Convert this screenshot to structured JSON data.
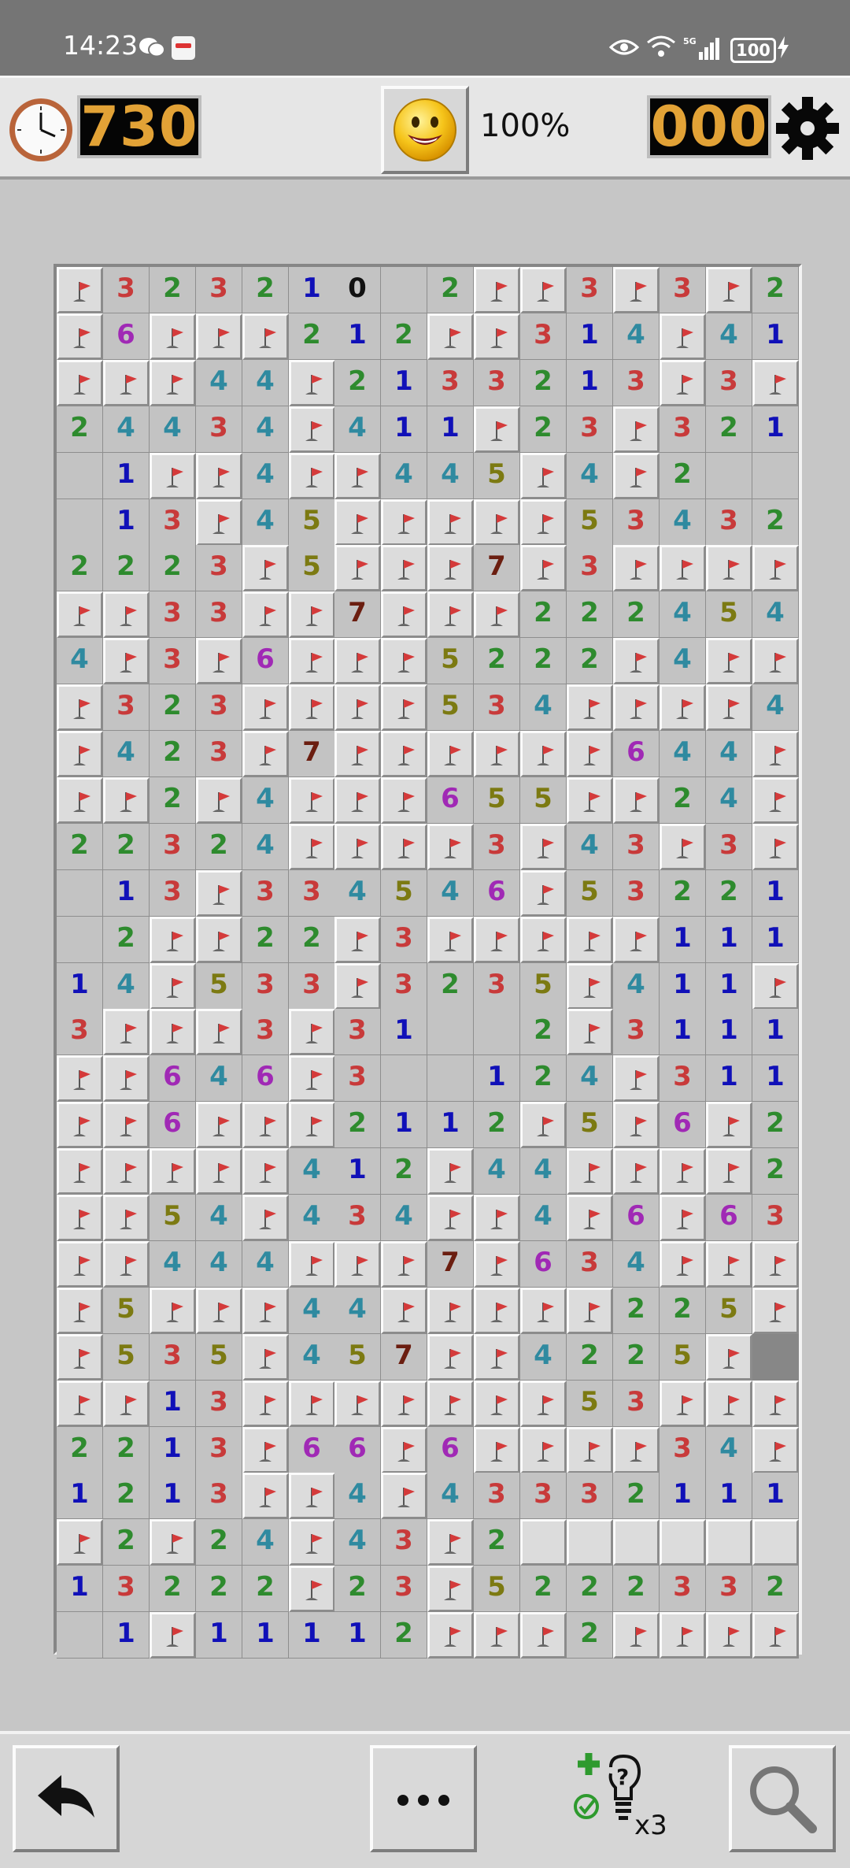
{
  "status_bar": {
    "time": "14:23",
    "battery": "100"
  },
  "toolbar": {
    "timer": "730",
    "mines_remaining": "000",
    "progress": "100%"
  },
  "board": {
    "columns": 16,
    "rows_count": 30,
    "legend": "F = flagged covered tile, H = covered tile, '.' = revealed empty, digit = revealed number",
    "rows": [
      "F323210.2FF3F3F2.",
      "F6FFF212FF314F41",
      "FFF44F2133213F3F",
      "24434F411F23F321",
      ".1FF4FF445F4F2..",
      ".13F45FFFFF53432",
      "2223F5FFF7F3FFFF",
      "FF33FF7FFF22245 4",
      "4F3F6FFF5222F4FF",
      "F323FFFF534FFFF4",
      "F423F7FFFFFF644F",
      "FF2F4FFF655FF24F",
      "22324FFFF3F43F3F",
      ".13F334546F5322 1",
      ".2FF22F3FFFFF111",
      "14F533F3235F4 11F",
      "3FFF3F31..2F3111",
      "FF646F3..124F311",
      "FF6FFF2112F5F6F2",
      "FFFFF412F44FFFF2",
      "FF54F434FF4F6F63",
      "FF444FFF7F634FFF",
      "F5FFF44FFFFF225F",
      "F535F457FF42 25F",
      "FF13FFFFFFF53FFF",
      "2213F66F6FFFF34F",
      "1213FF4F4333 2111",
      "F2F24F43F2HHHHHH",
      "1322 2F23F522 2332",
      ".1F1111 2FFF2FFFF"
    ]
  },
  "colors": {
    "n1": "#1010b8",
    "n2": "#2e8b2e",
    "n3": "#c83a3a",
    "n4": "#2f8aa0",
    "n5": "#7c7a12",
    "n6": "#a029b5",
    "n7": "#6b1e10",
    "flag": "#d43a3a"
  },
  "bottom_bar": {
    "hint_count": "x3"
  },
  "icons": [
    "clock-icon",
    "smiley-icon",
    "gear-icon",
    "undo-arrow-icon",
    "more-dots-icon",
    "hint-bulb-icon",
    "magnifier-icon",
    "flag-icon"
  ]
}
